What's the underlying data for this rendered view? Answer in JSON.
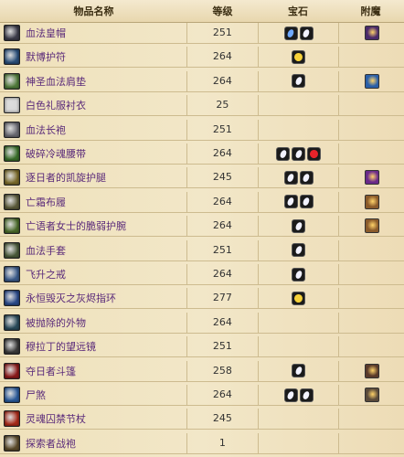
{
  "header": {
    "col_name": "物品名称",
    "col_level": "等级",
    "col_gems": "宝石",
    "col_enchant": "附魔"
  },
  "colors": {
    "name_text": "#5a2a7a",
    "gem_white": "#f2f2ff",
    "gem_yellow": "#f7d23a",
    "gem_red": "#e8232a",
    "gem_blue": "#6fa9ff"
  },
  "items": [
    {
      "name": "血法皇帽",
      "level": "251",
      "icon_color": "#3c3c4a",
      "gems": [
        "blue",
        "white"
      ],
      "enchant": "#4a2a6a"
    },
    {
      "name": "默博护符",
      "level": "264",
      "icon_color": "#2a4f7a",
      "gems": [
        "yellow"
      ],
      "enchant": ""
    },
    {
      "name": "神圣血法肩垫",
      "level": "264",
      "icon_color": "#4f7a3a",
      "gems": [
        "white"
      ],
      "enchant": "#2a5fa8"
    },
    {
      "name": "白色礼服衬衣",
      "level": "25",
      "icon_color": "#d8d8d8",
      "gems": [],
      "enchant": ""
    },
    {
      "name": "血法长袍",
      "level": "251",
      "icon_color": "#6a6a72",
      "gems": [],
      "enchant": ""
    },
    {
      "name": "破碎冷魂腰带",
      "level": "264",
      "icon_color": "#3a6e2a",
      "gems": [
        "white",
        "white",
        "red"
      ],
      "enchant": ""
    },
    {
      "name": "逐日者的凯旋护腿",
      "level": "245",
      "icon_color": "#7a6a2a",
      "gems": [
        "white",
        "white"
      ],
      "enchant": "#6a2a8a"
    },
    {
      "name": "亡霜布履",
      "level": "264",
      "icon_color": "#5a5a3a",
      "gems": [
        "white",
        "white"
      ],
      "enchant": "#8a5a2a"
    },
    {
      "name": "亡语者女士的脆弱护腕",
      "level": "264",
      "icon_color": "#4a6a2a",
      "gems": [
        "white"
      ],
      "enchant": "#8a5a2a"
    },
    {
      "name": "血法手套",
      "level": "251",
      "icon_color": "#4a5a3a",
      "gems": [
        "white"
      ],
      "enchant": ""
    },
    {
      "name": "飞升之戒",
      "level": "264",
      "icon_color": "#3a5a8a",
      "gems": [
        "white"
      ],
      "enchant": ""
    },
    {
      "name": "永恒毁灭之灰烬指环",
      "level": "277",
      "icon_color": "#2a4a8a",
      "gems": [
        "yellow"
      ],
      "enchant": ""
    },
    {
      "name": "被抛除的外物",
      "level": "264",
      "icon_color": "#2a4a5a",
      "gems": [],
      "enchant": ""
    },
    {
      "name": "穆拉丁的望远镜",
      "level": "251",
      "icon_color": "#3a3a3a",
      "gems": [],
      "enchant": ""
    },
    {
      "name": "夺日者斗篷",
      "level": "258",
      "icon_color": "#8a1a1a",
      "gems": [
        "white"
      ],
      "enchant": "#5a3a2a"
    },
    {
      "name": "尸煞",
      "level": "264",
      "icon_color": "#2a5a9a",
      "gems": [
        "white",
        "white"
      ],
      "enchant": "#5a4a3a"
    },
    {
      "name": "灵魂囚禁节杖",
      "level": "245",
      "icon_color": "#a82a1a",
      "gems": [],
      "enchant": ""
    },
    {
      "name": "探索者战袍",
      "level": "1",
      "icon_color": "#5a4a2a",
      "gems": [],
      "enchant": ""
    }
  ]
}
